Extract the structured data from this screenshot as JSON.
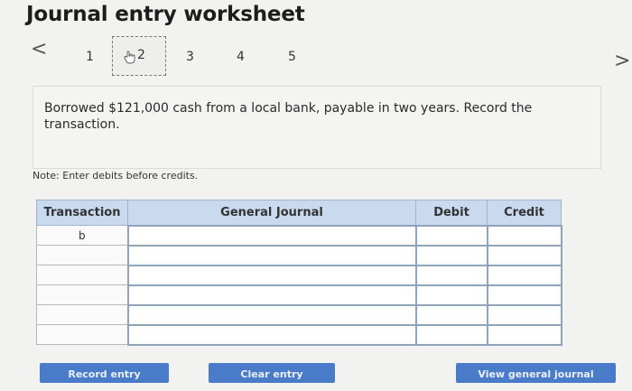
{
  "title": "Journal entry worksheet",
  "navigation": {
    "prev_glyph": "<",
    "next_glyph": ">",
    "steps": [
      "1",
      "2",
      "3",
      "4",
      "5"
    ],
    "active_step": "2",
    "active_step_icon": "hand-pointer-icon"
  },
  "prompt": "Borrowed $121,000 cash from a local bank, payable in two years. Record the transaction.",
  "note": "Note: Enter debits before credits.",
  "table": {
    "headers": [
      "Transaction",
      "General Journal",
      "Debit",
      "Credit"
    ],
    "rows": [
      [
        "b",
        "",
        "",
        ""
      ],
      [
        "",
        "",
        "",
        ""
      ],
      [
        "",
        "",
        "",
        ""
      ],
      [
        "",
        "",
        "",
        ""
      ],
      [
        "",
        "",
        "",
        ""
      ],
      [
        "",
        "",
        "",
        ""
      ]
    ]
  },
  "buttons": {
    "record": "Record entry",
    "clear": "Clear entry",
    "view": "View general journal"
  },
  "colors": {
    "header_bg": "#c9d9ee",
    "button_bg": "#4a7bc8"
  }
}
